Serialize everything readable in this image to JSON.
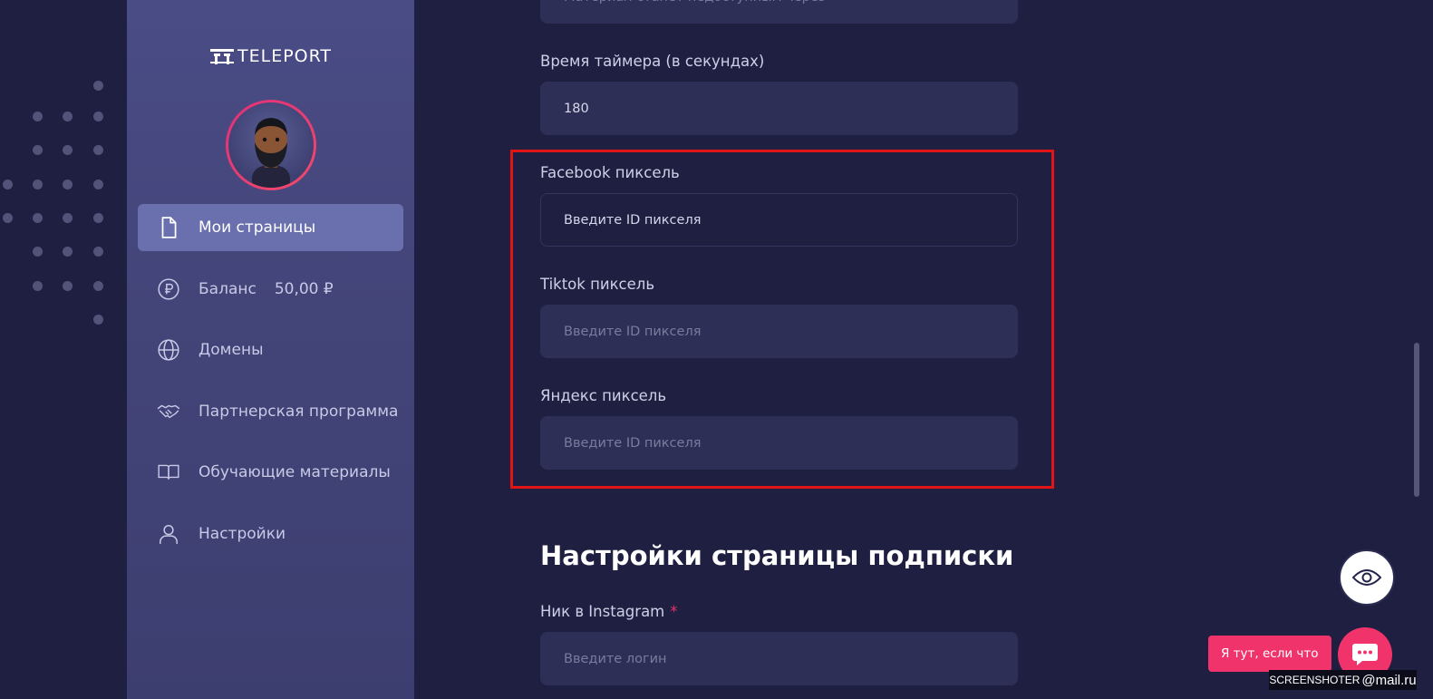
{
  "brand": {
    "logo_text": "TELEPORT"
  },
  "sidebar": {
    "items": [
      {
        "label": "Мои страницы",
        "icon": "document-icon",
        "active": true
      },
      {
        "label": "Баланс",
        "value": "50,00 ₽",
        "icon": "ruble-icon"
      },
      {
        "label": "Домены",
        "icon": "globe-icon"
      },
      {
        "label": "Партнерская программа",
        "icon": "handshake-icon"
      },
      {
        "label": "Обучающие материалы",
        "icon": "book-icon"
      },
      {
        "label": "Настройки",
        "icon": "user-icon"
      }
    ]
  },
  "form": {
    "top_partial_value": "Материал станет недоступным через",
    "timer": {
      "label": "Время таймера (в секундах)",
      "value": "180"
    },
    "facebook": {
      "label": "Facebook пиксель",
      "placeholder": "Введите ID пикселя"
    },
    "tiktok": {
      "label": "Tiktok пиксель",
      "placeholder": "Введите ID пикселя"
    },
    "yandex": {
      "label": "Яндекс пиксель",
      "placeholder": "Введите ID пикселя"
    },
    "subscribe_section_title": "Настройки страницы подписки",
    "instagram": {
      "label": "Ник в Instagram",
      "required_mark": "*",
      "placeholder": "Введите логин"
    }
  },
  "floating": {
    "chat_bubble_text": "Я тут, если что",
    "watermark_prefix": "SCREENSHOTER",
    "watermark_suffix": "@mail.ru"
  },
  "colors": {
    "background": "#1f1f42",
    "sidebar": "#434478",
    "active_item": "#6a6fad",
    "input_bg": "#2e2f56",
    "accent_pink": "#f0336b",
    "highlight_red": "#e01515"
  }
}
